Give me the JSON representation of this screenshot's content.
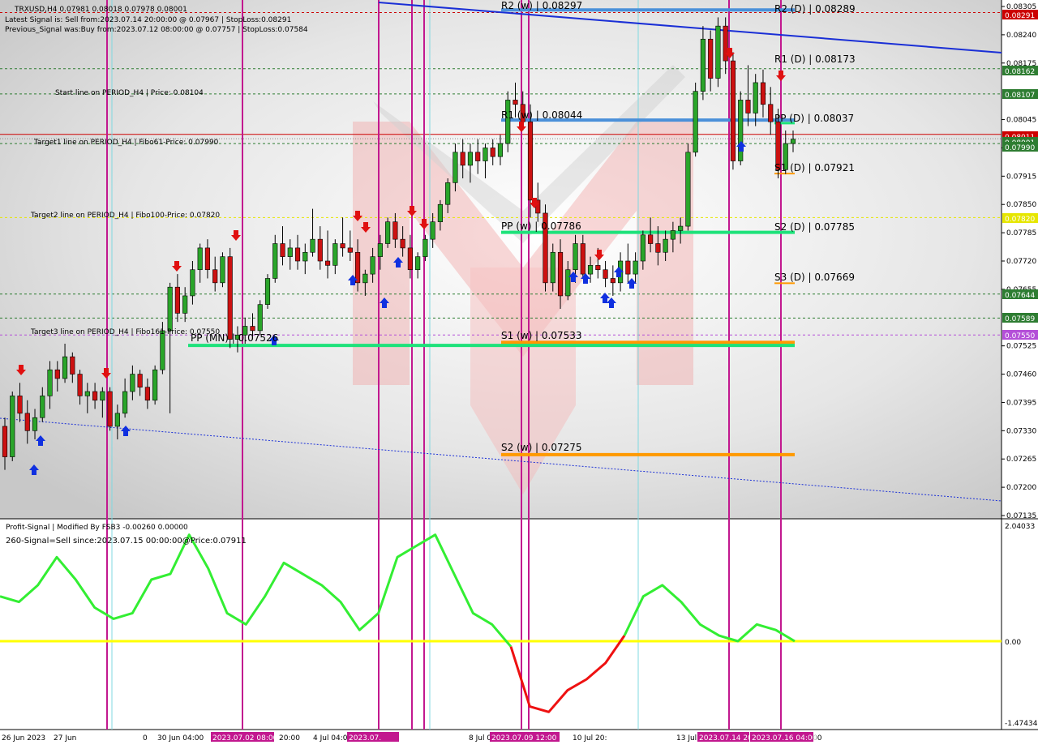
{
  "header": {
    "symbol_line": "TRXUSD,H4 0.07981 0.08018 0.07978 0.08001",
    "latest_signal": "Latest Signal is: Sell from:2023.07.14 20:00:00 @ 0.07967 | StopLoss:0.08291",
    "previous_signal": "Previous_Signal was:Buy from:2023.07.12 08:00:00 @ 0.07757 | StopLoss:0.07584"
  },
  "period_lines": {
    "start": "Start line on PERIOD_H4 | Price: 0.08104",
    "target1": "Target1 line on PERIOD_H4 | Fibo61-Price: 0.07990",
    "target2": "Target2 line on PERIOD_H4 | Fibo100-Price: 0.07820",
    "target3": "Target3 line on PERIOD_H4 | Fibo161-Price: 0.07550"
  },
  "pivots": {
    "r2w": "R2 (w) | 0.08297",
    "r1w": "R1 (w) | 0.08044",
    "ppw": "PP (w) | 0.07786",
    "s1w": "S1 (w) | 0.07533",
    "s2w": "S2 (w) | 0.07275",
    "r2d": "R2 (D) | 0.08289",
    "r1d": "R1 (D) | 0.08173",
    "ppd": "PP (D) | 0.08037",
    "s1d": "S1 (D) | 0.07921",
    "s2d": "S2 (D) | 0.07785",
    "s3d": "S3 (D) | 0.07669",
    "ppmn": "PP (MN) | 0.07526"
  },
  "price_axis": {
    "ticks": [
      "0.08305",
      "0.08240",
      "0.08175",
      "0.08045",
      "0.07980",
      "0.07915",
      "0.07850",
      "0.07785",
      "0.07720",
      "0.07655",
      "0.07525",
      "0.07460",
      "0.07395",
      "0.07330",
      "0.07265",
      "0.07200",
      "0.07135"
    ],
    "badges": [
      {
        "text": "0.08291",
        "color": "#cc0000"
      },
      {
        "text": "0.08162",
        "color": "#2e7d32"
      },
      {
        "text": "0.08107",
        "color": "#2e7d32"
      },
      {
        "text": "0.08011",
        "color": "#cc0000"
      },
      {
        "text": "0.08001",
        "color": "#2e7d32"
      },
      {
        "text": "0.07990",
        "color": "#2e7d32"
      },
      {
        "text": "0.07820",
        "color": "#e6e600"
      },
      {
        "text": "0.07644",
        "color": "#2e7d32"
      },
      {
        "text": "0.07589",
        "color": "#2e7d32"
      },
      {
        "text": "0.07550",
        "color": "#b44fd8"
      }
    ]
  },
  "indicator": {
    "title": "Profit-Signal | Modified By FSB3 -0.00260 0.00000",
    "signal": "260-Signal=Sell since:2023.07.15 00:00:00@Price:0.07911",
    "axis_ticks": [
      "2.04033",
      "0.00",
      "-1.47434"
    ]
  },
  "time_axis": {
    "labels": [
      "26 Jun 2023",
      "27 Jun",
      "0",
      "30 Jun 04:00",
      "20:00",
      "4 Jul 04:00",
      "8 Jul 0",
      "10 Jul 20:",
      "13 Jul",
      "00"
    ],
    "highlights": [
      "2023.07.02 08:00",
      "2023.07.",
      "2023.07.09 12:00",
      "2023.07.14 20",
      "2023.07.16 04:00"
    ]
  },
  "chart_data": {
    "type": "candlestick",
    "title": "TRXUSD,H4",
    "price_range": [
      0.07135,
      0.08305
    ],
    "candles": [
      [
        0.0734,
        0.0736,
        0.0724,
        0.0727
      ],
      [
        0.0727,
        0.0742,
        0.0726,
        0.0741
      ],
      [
        0.0741,
        0.0744,
        0.0735,
        0.0737
      ],
      [
        0.0737,
        0.074,
        0.073,
        0.0733
      ],
      [
        0.0733,
        0.0738,
        0.0731,
        0.0736
      ],
      [
        0.0736,
        0.0743,
        0.0735,
        0.0741
      ],
      [
        0.0741,
        0.0749,
        0.0738,
        0.0747
      ],
      [
        0.0747,
        0.0749,
        0.0742,
        0.0745
      ],
      [
        0.0745,
        0.0753,
        0.0744,
        0.075
      ],
      [
        0.075,
        0.0751,
        0.0744,
        0.0746
      ],
      [
        0.0746,
        0.0747,
        0.0739,
        0.0741
      ],
      [
        0.0741,
        0.0744,
        0.0737,
        0.0742
      ],
      [
        0.0742,
        0.0744,
        0.0738,
        0.074
      ],
      [
        0.074,
        0.0743,
        0.0736,
        0.0742
      ],
      [
        0.0742,
        0.0743,
        0.0733,
        0.0734
      ],
      [
        0.0734,
        0.0739,
        0.0731,
        0.0737
      ],
      [
        0.0737,
        0.0745,
        0.0736,
        0.0742
      ],
      [
        0.0742,
        0.0748,
        0.074,
        0.0746
      ],
      [
        0.0746,
        0.0747,
        0.0741,
        0.0743
      ],
      [
        0.0743,
        0.0745,
        0.0738,
        0.074
      ],
      [
        0.074,
        0.0748,
        0.0739,
        0.0747
      ],
      [
        0.0747,
        0.0758,
        0.0746,
        0.0756
      ],
      [
        0.0756,
        0.0767,
        0.0737,
        0.0766
      ],
      [
        0.0766,
        0.0769,
        0.0758,
        0.076
      ],
      [
        0.076,
        0.0766,
        0.0758,
        0.0764
      ],
      [
        0.0764,
        0.0772,
        0.0762,
        0.077
      ],
      [
        0.077,
        0.0776,
        0.0767,
        0.0775
      ],
      [
        0.0775,
        0.0777,
        0.0768,
        0.077
      ],
      [
        0.077,
        0.0773,
        0.0765,
        0.0767
      ],
      [
        0.0767,
        0.0774,
        0.0766,
        0.0773
      ],
      [
        0.0773,
        0.0775,
        0.0752,
        0.0754
      ],
      [
        0.0754,
        0.0757,
        0.0751,
        0.0755
      ],
      [
        0.0755,
        0.0759,
        0.0753,
        0.0757
      ],
      [
        0.0757,
        0.076,
        0.0754,
        0.0756
      ],
      [
        0.0756,
        0.0763,
        0.0755,
        0.0762
      ],
      [
        0.0762,
        0.0769,
        0.0761,
        0.0768
      ],
      [
        0.0768,
        0.0778,
        0.0767,
        0.0776
      ],
      [
        0.0776,
        0.078,
        0.0771,
        0.0773
      ],
      [
        0.0773,
        0.0777,
        0.077,
        0.0775
      ],
      [
        0.0775,
        0.0778,
        0.077,
        0.0772
      ],
      [
        0.0772,
        0.0776,
        0.0769,
        0.0774
      ],
      [
        0.0774,
        0.0784,
        0.0773,
        0.0777
      ],
      [
        0.0777,
        0.078,
        0.077,
        0.0772
      ],
      [
        0.0772,
        0.0779,
        0.0768,
        0.0771
      ],
      [
        0.0771,
        0.0777,
        0.0769,
        0.0776
      ],
      [
        0.0776,
        0.0782,
        0.0773,
        0.0775
      ],
      [
        0.0775,
        0.0779,
        0.0772,
        0.0774
      ],
      [
        0.0774,
        0.0777,
        0.0765,
        0.0767
      ],
      [
        0.0767,
        0.077,
        0.0764,
        0.0769
      ],
      [
        0.0769,
        0.0775,
        0.0767,
        0.0773
      ],
      [
        0.0773,
        0.0778,
        0.077,
        0.0776
      ],
      [
        0.0776,
        0.0782,
        0.0775,
        0.0781
      ],
      [
        0.0781,
        0.0783,
        0.0775,
        0.0777
      ],
      [
        0.0777,
        0.078,
        0.0773,
        0.0775
      ],
      [
        0.0775,
        0.0778,
        0.0768,
        0.077
      ],
      [
        0.077,
        0.0774,
        0.0768,
        0.0773
      ],
      [
        0.0773,
        0.0778,
        0.0772,
        0.0777
      ],
      [
        0.0777,
        0.0783,
        0.0775,
        0.0781
      ],
      [
        0.0781,
        0.0786,
        0.0779,
        0.0785
      ],
      [
        0.0785,
        0.0791,
        0.0783,
        0.079
      ],
      [
        0.079,
        0.0799,
        0.0788,
        0.0797
      ],
      [
        0.0797,
        0.08,
        0.0791,
        0.0794
      ],
      [
        0.0794,
        0.0799,
        0.079,
        0.0797
      ],
      [
        0.0797,
        0.08,
        0.0792,
        0.0795
      ],
      [
        0.0795,
        0.0799,
        0.0791,
        0.0798
      ],
      [
        0.0798,
        0.08,
        0.0794,
        0.0796
      ],
      [
        0.0796,
        0.0801,
        0.0794,
        0.0799
      ],
      [
        0.0799,
        0.0811,
        0.0797,
        0.0809
      ],
      [
        0.0809,
        0.0813,
        0.0805,
        0.0808
      ],
      [
        0.0808,
        0.0811,
        0.0802,
        0.0804
      ],
      [
        0.0804,
        0.0808,
        0.0782,
        0.0786
      ],
      [
        0.0786,
        0.079,
        0.0781,
        0.0783
      ],
      [
        0.0783,
        0.0785,
        0.0765,
        0.0767
      ],
      [
        0.0767,
        0.0776,
        0.0765,
        0.0774
      ],
      [
        0.0774,
        0.0777,
        0.0761,
        0.0764
      ],
      [
        0.0764,
        0.0772,
        0.0763,
        0.077
      ],
      [
        0.077,
        0.0778,
        0.0767,
        0.0776
      ],
      [
        0.0776,
        0.0778,
        0.0768,
        0.0769
      ],
      [
        0.0769,
        0.0773,
        0.0767,
        0.0771
      ],
      [
        0.0771,
        0.0775,
        0.0768,
        0.077
      ],
      [
        0.077,
        0.0772,
        0.0766,
        0.0768
      ],
      [
        0.0768,
        0.0771,
        0.0764,
        0.0767
      ],
      [
        0.0767,
        0.0774,
        0.0765,
        0.0772
      ],
      [
        0.0772,
        0.0776,
        0.0767,
        0.0769
      ],
      [
        0.0769,
        0.0774,
        0.0767,
        0.0772
      ],
      [
        0.0772,
        0.0779,
        0.077,
        0.0778
      ],
      [
        0.0778,
        0.0782,
        0.0774,
        0.0776
      ],
      [
        0.0776,
        0.078,
        0.0771,
        0.0774
      ],
      [
        0.0774,
        0.0779,
        0.0772,
        0.0777
      ],
      [
        0.0777,
        0.0781,
        0.0774,
        0.0779
      ],
      [
        0.0779,
        0.0782,
        0.0776,
        0.078
      ],
      [
        0.078,
        0.0799,
        0.0779,
        0.0797
      ],
      [
        0.0797,
        0.0813,
        0.0796,
        0.0811
      ],
      [
        0.0811,
        0.0826,
        0.0809,
        0.0823
      ],
      [
        0.0823,
        0.0825,
        0.0811,
        0.0814
      ],
      [
        0.0814,
        0.0828,
        0.0812,
        0.0826
      ],
      [
        0.0826,
        0.0828,
        0.0815,
        0.0818
      ],
      [
        0.0818,
        0.082,
        0.0793,
        0.0795
      ],
      [
        0.0795,
        0.0811,
        0.0794,
        0.0809
      ],
      [
        0.0809,
        0.0817,
        0.0803,
        0.0806
      ],
      [
        0.0806,
        0.0815,
        0.0803,
        0.0813
      ],
      [
        0.0813,
        0.0816,
        0.0805,
        0.0808
      ],
      [
        0.0808,
        0.0812,
        0.0801,
        0.0804
      ],
      [
        0.0804,
        0.0807,
        0.0791,
        0.0793
      ],
      [
        0.0793,
        0.0802,
        0.0792,
        0.0799
      ],
      [
        0.0799,
        0.0802,
        0.0797,
        0.08
      ]
    ],
    "indicator_series": [
      {
        "name": "Profit-Signal",
        "values": [
          0.8,
          0.7,
          1.0,
          1.5,
          1.1,
          0.6,
          0.4,
          0.5,
          1.1,
          1.2,
          1.9,
          1.3,
          0.5,
          0.3,
          0.8,
          1.4,
          1.2,
          1.0,
          0.7,
          0.2,
          0.5,
          1.5,
          1.7,
          1.9,
          1.2,
          0.5,
          0.3,
          -0.1,
          -1.2,
          -1.3,
          -0.9,
          -0.7,
          -0.4,
          0.1,
          0.8,
          1.0,
          0.7,
          0.3,
          0.1,
          0.0,
          0.3,
          0.2,
          0.0
        ]
      },
      {
        "name": "Zero line",
        "values": [
          0.0
        ]
      }
    ]
  },
  "colors": {
    "bull": "#2aa52a",
    "bear": "#cc1111",
    "vline_magenta": "#c2188f",
    "vline_cyan": "#80d8e0",
    "weekly_blue": "#4a90d9",
    "daily_green": "#1de27a",
    "orange": "#ff9900",
    "trend_blue": "#1a2fd6",
    "ps_green": "#33ee33",
    "ps_red": "#ee1111",
    "zero_yellow": "#ffff00"
  }
}
